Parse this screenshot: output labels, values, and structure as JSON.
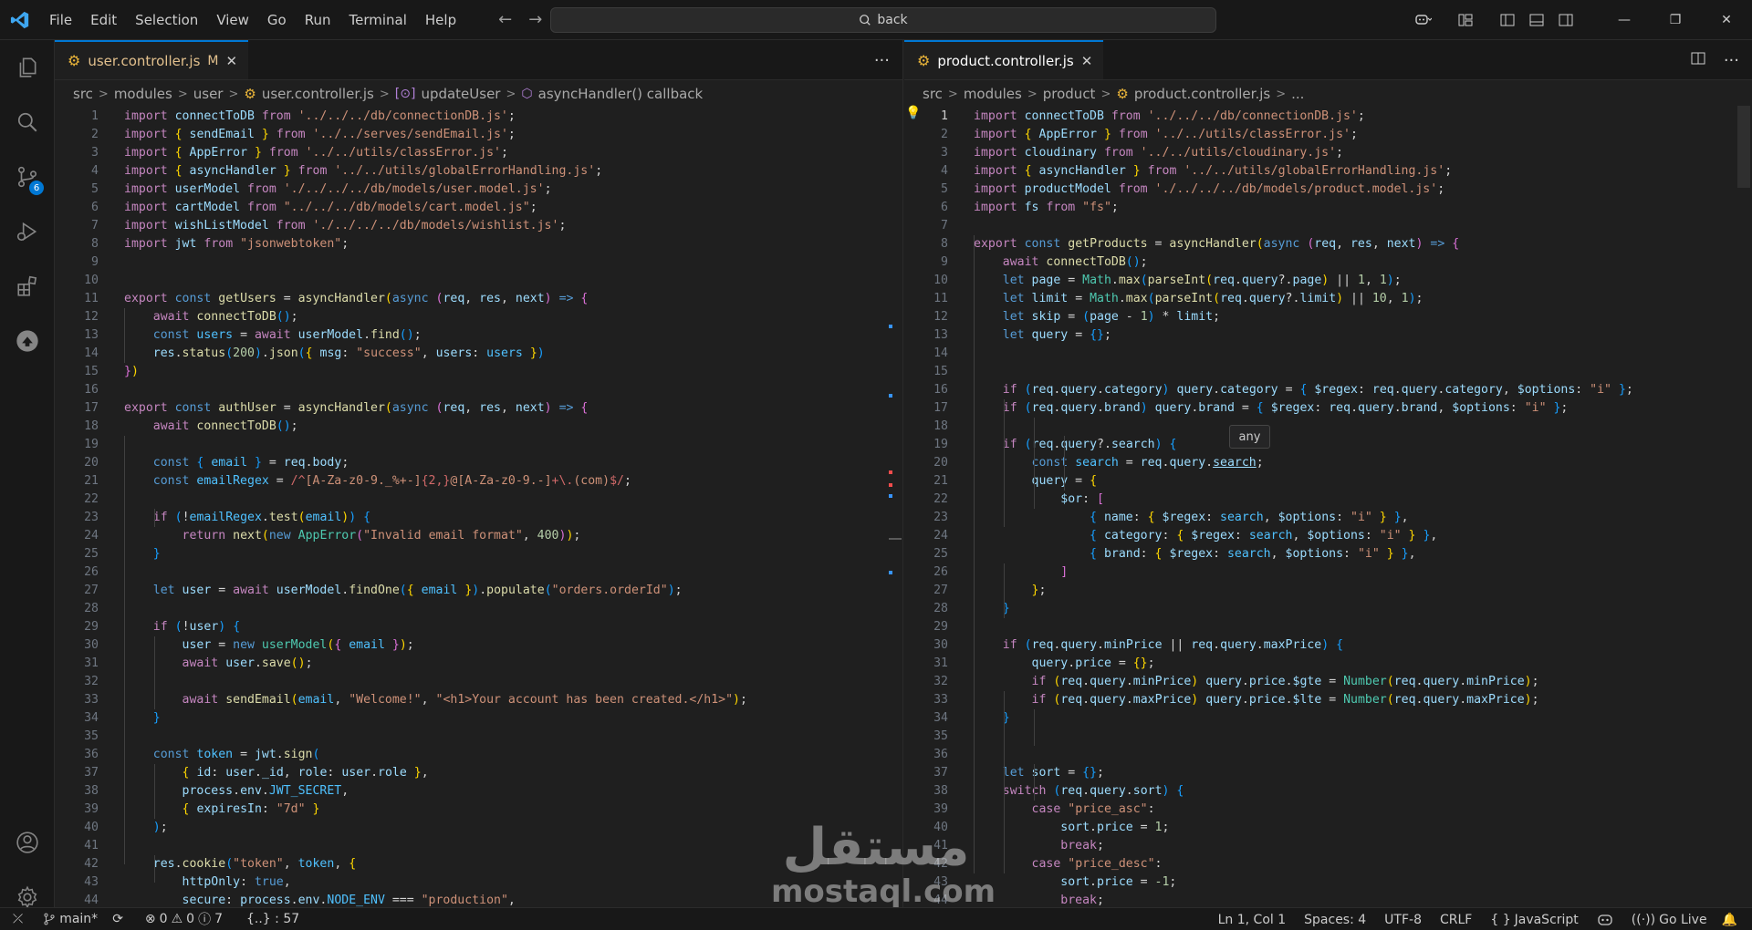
{
  "menu": [
    "File",
    "Edit",
    "Selection",
    "View",
    "Go",
    "Run",
    "Terminal",
    "Help"
  ],
  "command_center": {
    "text": "back"
  },
  "activity": {
    "scm_badge": "6"
  },
  "left": {
    "tab": {
      "label": "user.controller.js",
      "modified": "M"
    },
    "breadcrumb": [
      "src",
      "modules",
      "user",
      "user.controller.js",
      "updateUser",
      "asyncHandler() callback"
    ]
  },
  "right": {
    "tab": {
      "label": "product.controller.js"
    },
    "breadcrumb": [
      "src",
      "modules",
      "product",
      "product.controller.js",
      "..."
    ],
    "hover": "any"
  },
  "status": {
    "branch": "main*",
    "errors": "0",
    "warnings": "0",
    "info": "7",
    "selection": "{..} : 57",
    "position": "Ln 1, Col 1",
    "spaces": "Spaces: 4",
    "encoding": "UTF-8",
    "eol": "CRLF",
    "language": "JavaScript",
    "golive": "Go Live"
  },
  "watermark": {
    "arabic": "مستقل",
    "latin": "mostaql.com"
  }
}
